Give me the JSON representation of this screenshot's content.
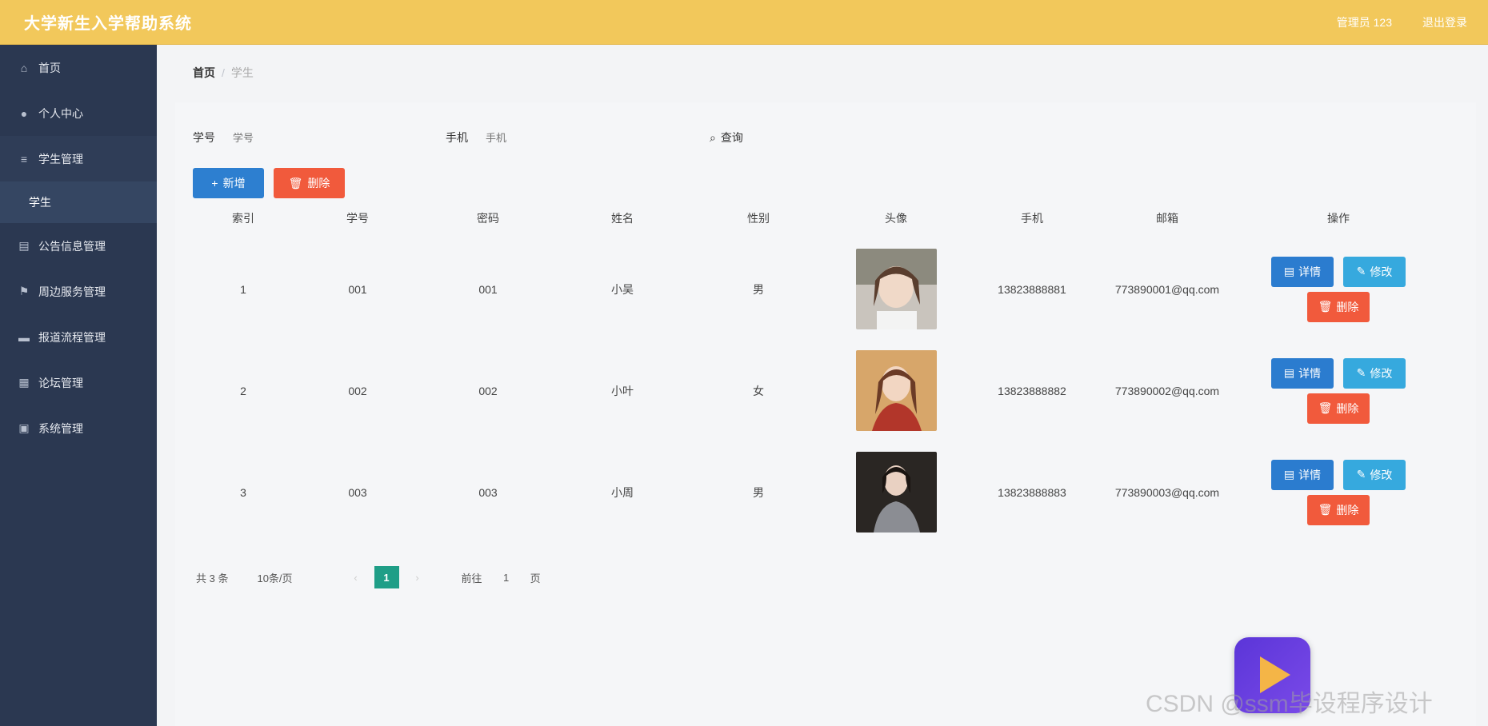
{
  "header": {
    "title": "大学新生入学帮助系统",
    "admin_label": "管理员 123",
    "logout_label": "退出登录"
  },
  "sidebar": {
    "items": [
      {
        "label": "首页",
        "icon": "home-icon"
      },
      {
        "label": "个人中心",
        "icon": "user-icon"
      },
      {
        "label": "学生管理",
        "icon": "list-icon"
      },
      {
        "label": "学生",
        "sub": true
      },
      {
        "label": "公告信息管理",
        "icon": "doc-icon"
      },
      {
        "label": "周边服务管理",
        "icon": "flag-icon"
      },
      {
        "label": "报道流程管理",
        "icon": "monitor-icon"
      },
      {
        "label": "论坛管理",
        "icon": "grid-icon"
      },
      {
        "label": "系统管理",
        "icon": "briefcase-icon"
      }
    ]
  },
  "breadcrumb": {
    "home": "首页",
    "separator": "/",
    "current": "学生"
  },
  "search": {
    "id_label": "学号",
    "id_placeholder": "学号",
    "phone_label": "手机",
    "phone_placeholder": "手机",
    "query_label": "查询"
  },
  "toolbar": {
    "add_label": "新增",
    "delete_label": "删除"
  },
  "table": {
    "headers": [
      "索引",
      "学号",
      "密码",
      "姓名",
      "性别",
      "头像",
      "手机",
      "邮箱",
      "操作"
    ],
    "rows": [
      {
        "index": "1",
        "id": "001",
        "password": "001",
        "name": "小吴",
        "sex": "男",
        "phone": "13823888881",
        "email": "773890001@qq.com"
      },
      {
        "index": "2",
        "id": "002",
        "password": "002",
        "name": "小叶",
        "sex": "女",
        "phone": "13823888882",
        "email": "773890002@qq.com"
      },
      {
        "index": "3",
        "id": "003",
        "password": "003",
        "name": "小周",
        "sex": "男",
        "phone": "13823888883",
        "email": "773890003@qq.com"
      }
    ],
    "ops": {
      "detail": "详情",
      "edit": "修改",
      "delete": "删除"
    }
  },
  "pagination": {
    "total": "共 3 条",
    "page_size": "10条/页",
    "current_page": "1",
    "goto_label": "前往",
    "goto_value": "1",
    "page_unit": "页"
  },
  "watermark": "CSDN @ssm毕设程序设计",
  "colors": {
    "header_bg": "#f2c85b",
    "sidebar_bg": "#2b3851",
    "primary": "#2d7fd0",
    "danger": "#f15a3c",
    "info": "#36a9de",
    "pager_active": "#1f9e87"
  }
}
